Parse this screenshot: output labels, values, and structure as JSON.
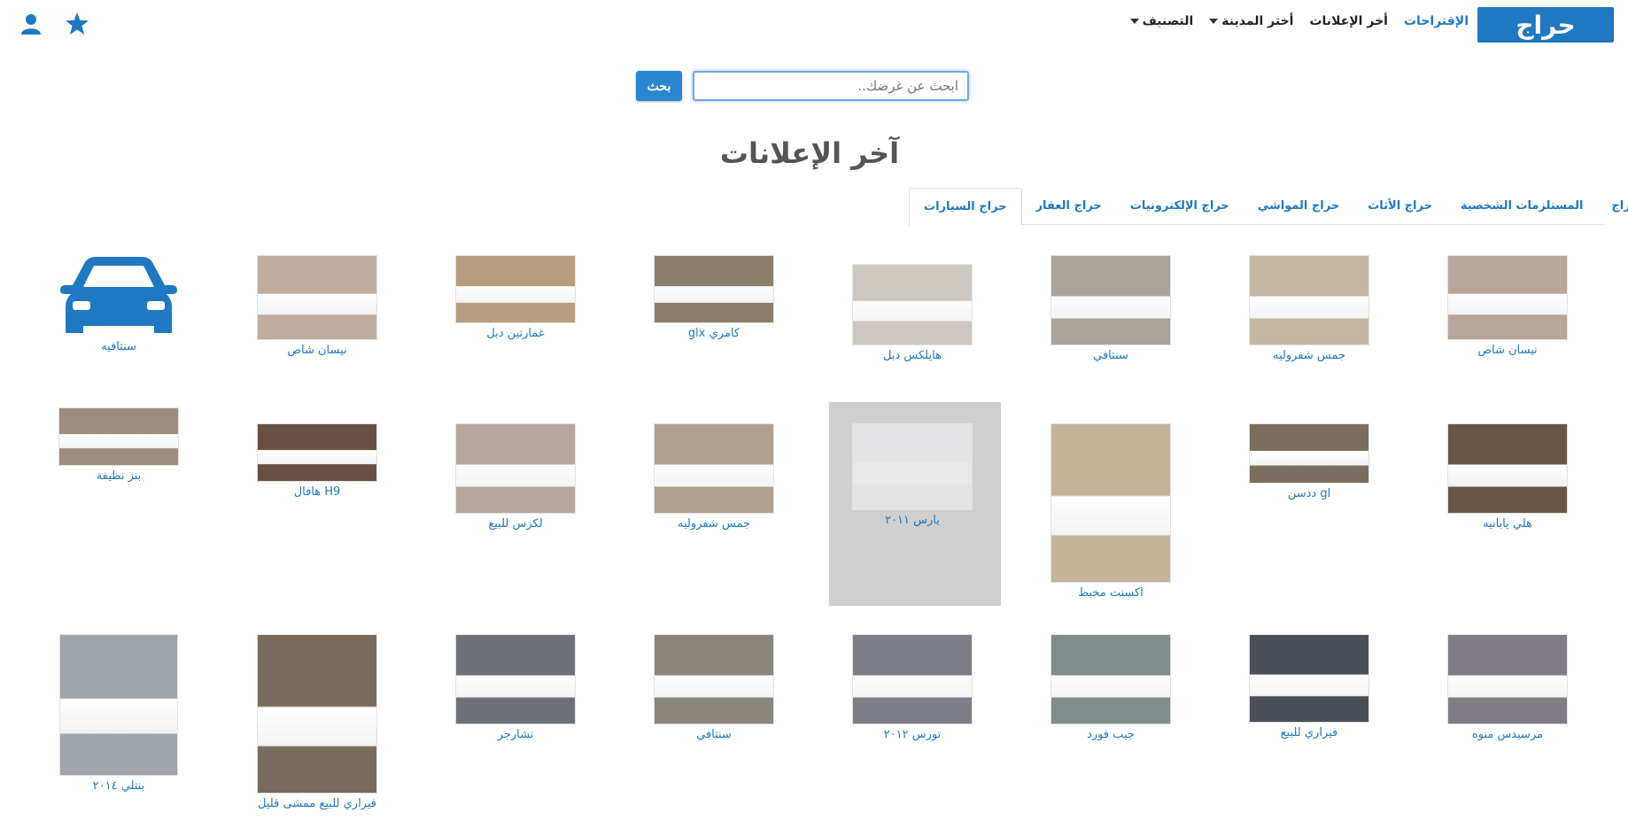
{
  "header": {
    "logo_text": "حراج",
    "nav": {
      "classification": "التصنيف",
      "city": "أختر المدينة",
      "latest": "أخر الإعلانات",
      "suggestions": "الإقتراحات"
    }
  },
  "search": {
    "placeholder": "ابحث عن غرضك..",
    "button": "بحث"
  },
  "page_title": "آخر الإعلانات",
  "tabs": [
    {
      "label": "حراج السيارات",
      "active": true
    },
    {
      "label": "حراج العقار"
    },
    {
      "label": "حراج الإلكترونيات"
    },
    {
      "label": "حراج المواشي"
    },
    {
      "label": "حراج الأثاث"
    },
    {
      "label": "المستلزمات الشخصية"
    },
    {
      "label": "كل حراج"
    }
  ],
  "listings": [
    {
      "label": "نيسان شاص",
      "color": "#b8a69a"
    },
    {
      "label": "جمس شفروليه",
      "color": "#c5b7a2"
    },
    {
      "label": "سنتافي",
      "color": "#a9a49c"
    },
    {
      "label": "هايلكس دبل",
      "color": "#cfc8c0"
    },
    {
      "label": "كامري glx",
      "color": "#8d7e6c"
    },
    {
      "label": "غمارتين دبل",
      "color": "#b69d7f"
    },
    {
      "label": "نيسان شاص",
      "color": "#c0ac9f"
    },
    {
      "label": "سنتافيه",
      "color": "#1f78c1"
    },
    {
      "label": "هلي يابانيه",
      "color": "#6b5647"
    },
    {
      "label": "gl ددسن",
      "color": "#7b6e5e"
    },
    {
      "label": "اكسنت مخبط",
      "color": "#c6b49a"
    },
    {
      "label": "يارس ٢٠١١",
      "color": "#e4e4e6"
    },
    {
      "label": "جمس شفروليه",
      "color": "#b0a18e"
    },
    {
      "label": "لكزس للبيع",
      "color": "#b4a79c"
    },
    {
      "label": "H9 هافال",
      "color": "#6a4f45"
    },
    {
      "label": "بنز نظيفة",
      "color": "#9d8d7e"
    },
    {
      "label": "مرسيدس منوه",
      "color": "#807e84"
    },
    {
      "label": "فيراري للبيع",
      "color": "#4b4f57"
    },
    {
      "label": "جيب فورد",
      "color": "#7f8c8a"
    },
    {
      "label": "تورس ٢٠١٢",
      "color": "#7d7e87"
    },
    {
      "label": "سنتافي",
      "color": "#8a867e"
    },
    {
      "label": "تشارجر",
      "color": "#6e7278"
    },
    {
      "label": "فيراري للبيع ممشى قليل",
      "color": "#786a5c"
    },
    {
      "label": "بنتلي ٢٠١٤",
      "color": "#9ea4a9"
    }
  ]
}
